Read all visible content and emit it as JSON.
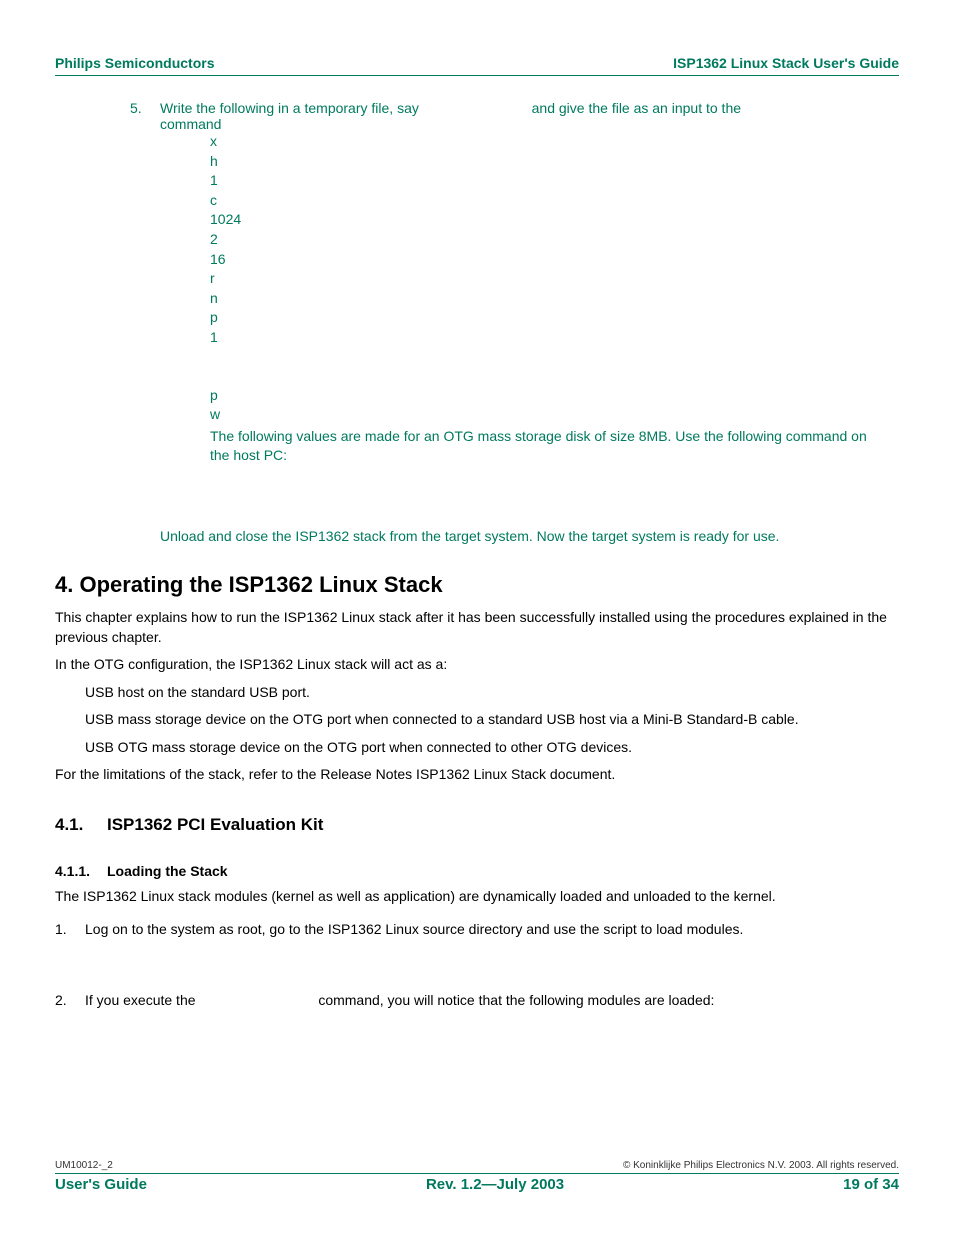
{
  "header": {
    "left": "Philips Semiconductors",
    "right": "ISP1362 Linux Stack User's Guide"
  },
  "step5": {
    "num": "5.",
    "text_a": "Write the following in a temporary file, say",
    "text_b": "and give the file as an input to the",
    "text_c": "command"
  },
  "code_lines": [
    "x",
    "h",
    "1",
    "c",
    "1024",
    "2",
    "16",
    "r",
    "n",
    "p",
    "1",
    "",
    "",
    "p",
    "w"
  ],
  "note": "The following values are made for an OTG mass storage disk of size 8MB. Use the following command on the host PC:",
  "unload": "Unload and close the ISP1362 stack from the target system. Now the target system is ready for use.",
  "section4": {
    "title": "4.  Operating the ISP1362 Linux Stack",
    "p1": "This chapter explains how to run the ISP1362 Linux stack after it has been successfully installed using the procedures explained in the previous chapter.",
    "p2": "In the OTG configuration, the ISP1362 Linux stack will act as a:",
    "b1": "USB host on the standard USB port.",
    "b2": "USB mass storage device on the OTG port when connected to a standard USB host via a Mini-B Standard-B cable.",
    "b3": "USB OTG mass storage device on the OTG port when connected to other OTG devices.",
    "p3": "For the limitations of the stack, refer to the Release Notes ISP1362 Linux Stack document."
  },
  "section41": {
    "num": "4.1.",
    "title": "ISP1362 PCI Evaluation Kit"
  },
  "section411": {
    "num": "4.1.1.",
    "title": "Loading the Stack",
    "p1": "The ISP1362 Linux stack modules (kernel as well as application) are dynamically loaded and unloaded to the kernel.",
    "item1_num": "1.",
    "item1": "Log on to the system as root, go to the ISP1362 Linux source directory and use the script to load modules.",
    "item2_num": "2.",
    "item2_a": "If you execute the",
    "item2_b": "command, you will notice that the following modules are loaded:"
  },
  "footer": {
    "doc_id": "UM10012-_2",
    "copyright": "© Koninklijke Philips Electronics N.V. 2003. All rights reserved.",
    "left": "User's Guide",
    "center": "Rev. 1.2—July 2003",
    "right": "19 of 34"
  }
}
